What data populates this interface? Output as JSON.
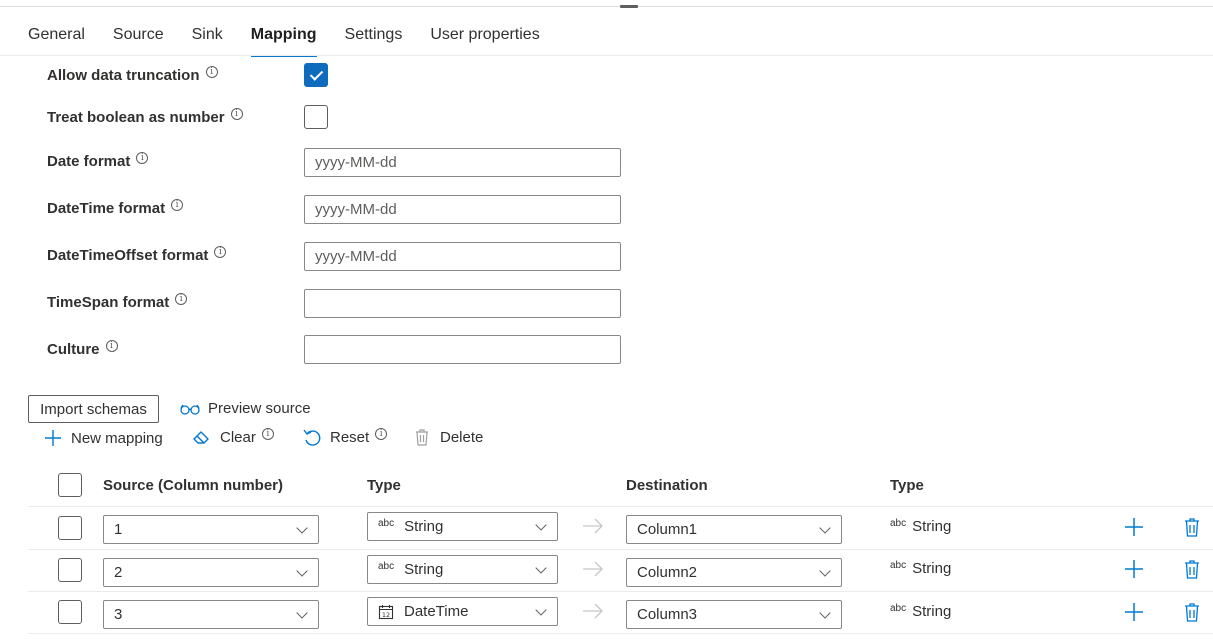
{
  "tabs": [
    {
      "label": "General",
      "active": false
    },
    {
      "label": "Source",
      "active": false
    },
    {
      "label": "Sink",
      "active": false
    },
    {
      "label": "Mapping",
      "active": true
    },
    {
      "label": "Settings",
      "active": false
    },
    {
      "label": "User properties",
      "active": false
    }
  ],
  "settings": {
    "allow_truncation": {
      "label": "Allow data truncation",
      "checked": true
    },
    "treat_boolean": {
      "label": "Treat boolean as number",
      "checked": false
    },
    "date_format": {
      "label": "Date format",
      "placeholder": "yyyy-MM-dd",
      "value": ""
    },
    "datetime_format": {
      "label": "DateTime format",
      "placeholder": "yyyy-MM-dd",
      "value": ""
    },
    "datetimeoffset_format": {
      "label": "DateTimeOffset format",
      "placeholder": "yyyy-MM-dd",
      "value": ""
    },
    "timespan_format": {
      "label": "TimeSpan format",
      "placeholder": "",
      "value": ""
    },
    "culture": {
      "label": "Culture",
      "placeholder": "",
      "value": ""
    }
  },
  "toolbar": {
    "import_schemas": "Import schemas",
    "preview_source": "Preview source",
    "new_mapping": "New mapping",
    "clear": "Clear",
    "reset": "Reset",
    "delete": "Delete"
  },
  "table": {
    "headers": {
      "source": "Source (Column number)",
      "source_type": "Type",
      "destination": "Destination",
      "destination_type": "Type"
    },
    "rows": [
      {
        "source": "1",
        "source_type": "String",
        "source_type_icon": "abc",
        "destination": "Column1",
        "destination_type": "String",
        "destination_type_icon": "abc"
      },
      {
        "source": "2",
        "source_type": "String",
        "source_type_icon": "abc",
        "destination": "Column2",
        "destination_type": "String",
        "destination_type_icon": "abc"
      },
      {
        "source": "3",
        "source_type": "DateTime",
        "source_type_icon": "calendar-icon",
        "destination": "Column3",
        "destination_type": "String",
        "destination_type_icon": "abc"
      }
    ]
  },
  "colors": {
    "accent": "#0078d4",
    "checkbox": "#0f6cbd",
    "border": "#8a8886",
    "text": "#323130"
  }
}
